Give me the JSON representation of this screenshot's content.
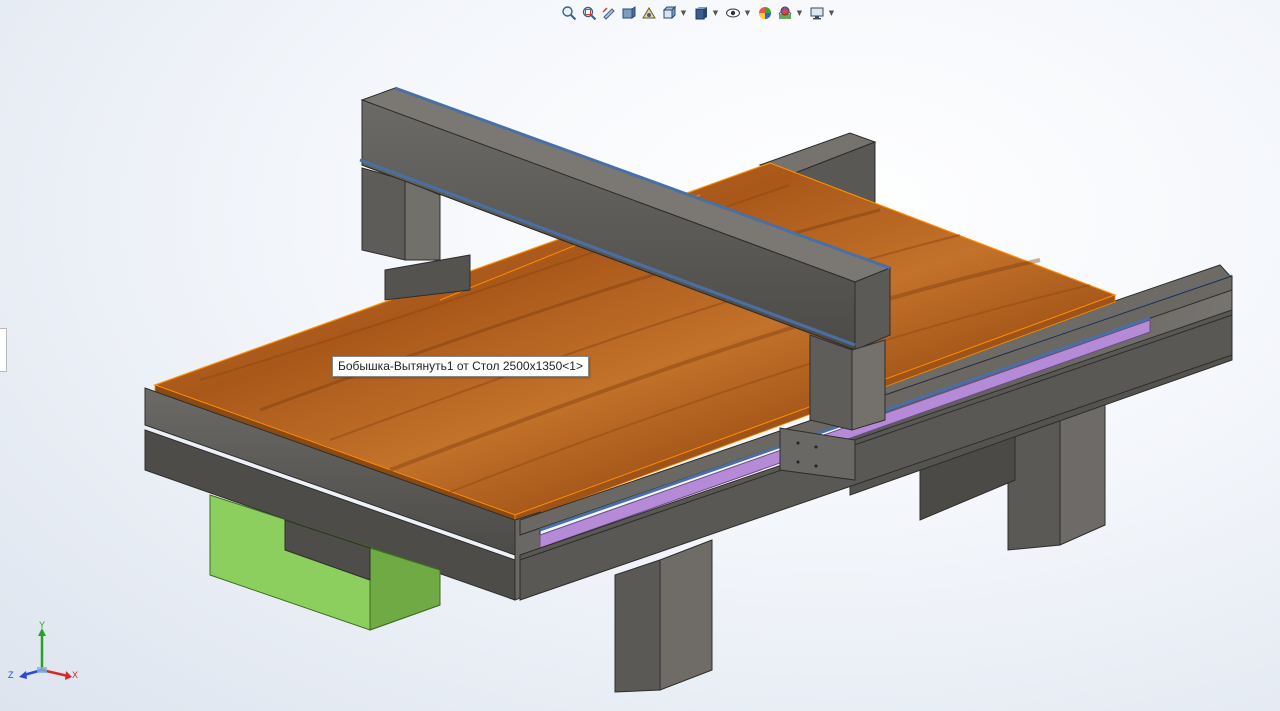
{
  "tooltip": {
    "text": "Бобышка-Вытянуть1 от Стол 2500x1350<1>"
  },
  "triad": {
    "x_label": "X",
    "y_label": "Y",
    "z_label": "Z"
  },
  "toolbar": {
    "buttons": [
      {
        "name": "zoom-to-fit-icon",
        "has_dropdown": false
      },
      {
        "name": "zoom-to-area-icon",
        "has_dropdown": false
      },
      {
        "name": "previous-view-icon",
        "has_dropdown": false
      },
      {
        "name": "section-view-icon",
        "has_dropdown": false
      },
      {
        "name": "dynamic-annotation-icon",
        "has_dropdown": false
      },
      {
        "name": "view-orientation-icon",
        "has_dropdown": true
      },
      {
        "name": "display-style-icon",
        "has_dropdown": true
      },
      {
        "name": "hide-show-items-icon",
        "has_dropdown": true
      },
      {
        "name": "edit-appearance-icon",
        "has_dropdown": false
      },
      {
        "name": "apply-scene-icon",
        "has_dropdown": true
      },
      {
        "name": "view-settings-icon",
        "has_dropdown": true
      }
    ]
  },
  "colors": {
    "steel": "#5c5a57",
    "steel_light": "#7a7773",
    "steel_dark": "#3f3d3b",
    "wood": "#b4641e",
    "wood_dark": "#8a4a14",
    "rail_blue": "#4a6fa5",
    "rail_purple": "#b58ad6",
    "drawer_green": "#8ccf5e",
    "selection_orange": "#ff8c00"
  }
}
